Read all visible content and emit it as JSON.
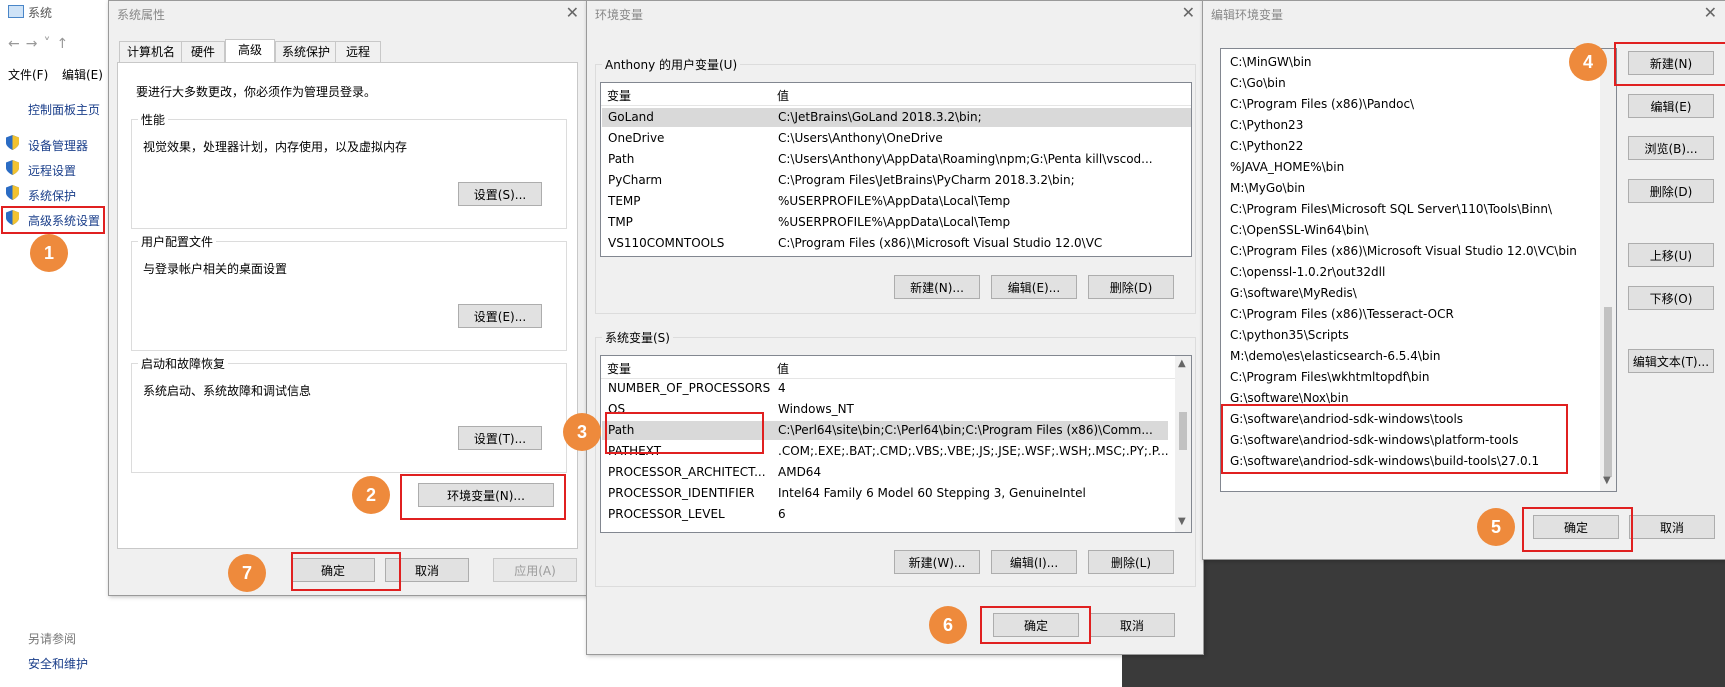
{
  "system": {
    "title": "系统",
    "menu": {
      "file": "文件(F)",
      "edit": "编辑(E)"
    },
    "control_panel_home": "控制面板主页",
    "links": [
      "设备管理器",
      "远程设置",
      "系统保护",
      "高级系统设置"
    ],
    "see_also": "另请参阅",
    "security_maintenance": "安全和维护"
  },
  "sys_props": {
    "title": "系统属性",
    "tabs": [
      "计算机名",
      "硬件",
      "高级",
      "系统保护",
      "远程"
    ],
    "admin_note": "要进行大多数更改，你必须作为管理员登录。",
    "perf": {
      "label": "性能",
      "desc": "视觉效果，处理器计划，内存使用，以及虚拟内存",
      "button": "设置(S)..."
    },
    "profile": {
      "label": "用户配置文件",
      "desc": "与登录帐户相关的桌面设置",
      "button": "设置(E)..."
    },
    "startup": {
      "label": "启动和故障恢复",
      "desc": "系统启动、系统故障和调试信息",
      "button": "设置(T)..."
    },
    "env_button": "环境变量(N)...",
    "ok": "确定",
    "cancel": "取消",
    "apply": "应用(A)"
  },
  "env_vars": {
    "title": "环境变量",
    "user_group": "Anthony 的用户变量(U)",
    "sys_group": "系统变量(S)",
    "col_var": "变量",
    "col_val": "值",
    "user_rows": [
      {
        "name": "GoLand",
        "value": "C:\\JetBrains\\GoLand 2018.3.2\\bin;"
      },
      {
        "name": "OneDrive",
        "value": "C:\\Users\\Anthony\\OneDrive"
      },
      {
        "name": "Path",
        "value": "C:\\Users\\Anthony\\AppData\\Roaming\\npm;G:\\Penta kill\\vscod..."
      },
      {
        "name": "PyCharm",
        "value": "C:\\Program Files\\JetBrains\\PyCharm 2018.3.2\\bin;"
      },
      {
        "name": "TEMP",
        "value": "%USERPROFILE%\\AppData\\Local\\Temp"
      },
      {
        "name": "TMP",
        "value": "%USERPROFILE%\\AppData\\Local\\Temp"
      },
      {
        "name": "VS110COMNTOOLS",
        "value": "C:\\Program Files (x86)\\Microsoft Visual Studio 12.0\\VC"
      }
    ],
    "sys_rows": [
      {
        "name": "NUMBER_OF_PROCESSORS",
        "value": "4"
      },
      {
        "name": "OS",
        "value": "Windows_NT"
      },
      {
        "name": "Path",
        "value": "C:\\Perl64\\site\\bin;C:\\Perl64\\bin;C:\\Program Files (x86)\\Comm..."
      },
      {
        "name": "PATHEXT",
        "value": ".COM;.EXE;.BAT;.CMD;.VBS;.VBE;.JS;.JSE;.WSF;.WSH;.MSC;.PY;.P..."
      },
      {
        "name": "PROCESSOR_ARCHITECT...",
        "value": "AMD64"
      },
      {
        "name": "PROCESSOR_IDENTIFIER",
        "value": "Intel64 Family 6 Model 60 Stepping 3, GenuineIntel"
      },
      {
        "name": "PROCESSOR_LEVEL",
        "value": "6"
      }
    ],
    "user_new": "新建(N)...",
    "user_edit": "编辑(E)...",
    "user_delete": "删除(D)",
    "sys_new": "新建(W)...",
    "sys_edit": "编辑(I)...",
    "sys_delete": "删除(L)",
    "ok": "确定",
    "cancel": "取消"
  },
  "edit_env": {
    "title": "编辑环境变量",
    "paths": [
      "C:\\MinGW\\bin",
      "C:\\Go\\bin",
      "C:\\Program Files (x86)\\Pandoc\\",
      "C:\\Python23",
      "C:\\Python22",
      "%JAVA_HOME%\\bin",
      "M:\\MyGo\\bin",
      "C:\\Program Files\\Microsoft SQL Server\\110\\Tools\\Binn\\",
      "C:\\OpenSSL-Win64\\bin\\",
      "C:\\Program Files (x86)\\Microsoft Visual Studio 12.0\\VC\\bin",
      "C:\\openssl-1.0.2r\\out32dll",
      "G:\\software\\MyRedis\\",
      "C:\\Program Files (x86)\\Tesseract-OCR",
      "C:\\python35\\Scripts",
      "M:\\demo\\es\\elasticsearch-6.5.4\\bin",
      "C:\\Program Files\\wkhtmltopdf\\bin",
      "G:\\software\\Nox\\bin",
      "G:\\software\\andriod-sdk-windows\\tools",
      "G:\\software\\andriod-sdk-windows\\platform-tools",
      "G:\\software\\andriod-sdk-windows\\build-tools\\27.0.1"
    ],
    "new": "新建(N)",
    "edit": "编辑(E)",
    "browse": "浏览(B)...",
    "delete": "删除(D)",
    "move_up": "上移(U)",
    "move_down": "下移(O)",
    "edit_text": "编辑文本(T)...",
    "ok": "确定",
    "cancel": "取消"
  },
  "badges": [
    "1",
    "2",
    "3",
    "4",
    "5",
    "6",
    "7"
  ],
  "colors": {
    "highlight": "#e02020",
    "badge": "#ee8a3c",
    "link": "#1a3e8a"
  }
}
